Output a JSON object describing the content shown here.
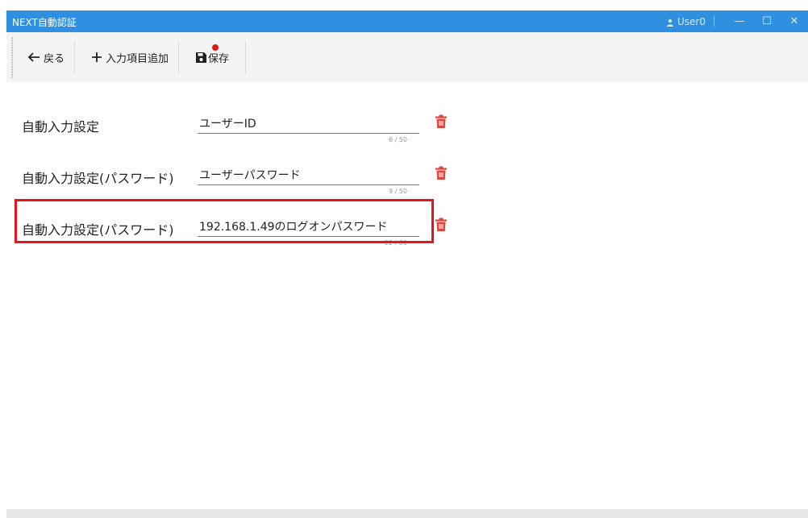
{
  "window": {
    "title": "NEXT自動認証",
    "user": "User0",
    "controls": {
      "minimize": "—",
      "maximize": "☐",
      "close": "✕"
    }
  },
  "toolbar": {
    "back_label": "戻る",
    "add_label": "入力項目追加",
    "save_label": "保存"
  },
  "fields": [
    {
      "label": "自動入力設定",
      "value": "ユーザーID",
      "counter": "6 / 50"
    },
    {
      "label": "自動入力設定(パスワード)",
      "value": "ユーザーパスワード",
      "counter": "9 / 50"
    },
    {
      "label": "自動入力設定(パスワード)",
      "value": "192.168.1.49のログオンパスワード",
      "counter": "22 / 50"
    }
  ],
  "colors": {
    "titlebar": "#2f8fe0",
    "delete_icon": "#e0473a",
    "highlight_border": "#e8141b",
    "unsaved_dot": "#e01818"
  },
  "icons": {
    "user": "person-icon",
    "back": "arrow-left-icon",
    "add": "plus-icon",
    "save": "floppy-disk-icon",
    "delete": "trash-icon"
  }
}
